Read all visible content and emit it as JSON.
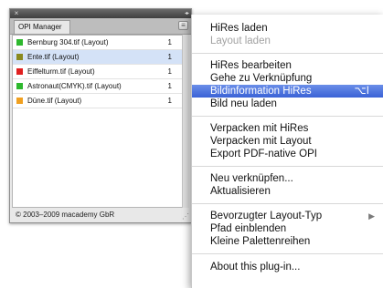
{
  "panel": {
    "tab_label": "OPI Manager",
    "footer": "© 2003–2009 macademy GbR",
    "rows": [
      {
        "name": "Bernburg 304.tif (Layout)",
        "count": "1",
        "color": "#2eb82e",
        "selected": false
      },
      {
        "name": "Ente.tif (Layout)",
        "count": "1",
        "color": "#8a8a20",
        "selected": true
      },
      {
        "name": "Eiffelturm.tif (Layout)",
        "count": "1",
        "color": "#e02020",
        "selected": false
      },
      {
        "name": "Astronaut(CMYK).tif (Layout)",
        "count": "1",
        "color": "#2eb82e",
        "selected": false
      },
      {
        "name": "Düne.tif (Layout)",
        "count": "1",
        "color": "#f0a020",
        "selected": false
      }
    ]
  },
  "menu": {
    "items": [
      {
        "label": "HiRes laden",
        "disabled": false
      },
      {
        "label": "Layout laden",
        "disabled": true
      },
      {
        "label": "HiRes bearbeiten",
        "disabled": false
      },
      {
        "label": "Gehe zu Verknüpfung",
        "disabled": false
      },
      {
        "label": "Bildinformation HiRes",
        "disabled": false,
        "highlighted": true,
        "shortcut": "⌥I"
      },
      {
        "label": "Bild neu laden",
        "disabled": false
      },
      {
        "label": "Verpacken mit HiRes",
        "disabled": false
      },
      {
        "label": "Verpacken mit Layout",
        "disabled": false
      },
      {
        "label": "Export PDF-native OPI",
        "disabled": false
      },
      {
        "label": "Neu verknüpfen...",
        "disabled": false
      },
      {
        "label": "Aktualisieren",
        "disabled": false
      },
      {
        "label": "Bevorzugter Layout-Typ",
        "disabled": false,
        "submenu": true
      },
      {
        "label": "Pfad einblenden",
        "disabled": false
      },
      {
        "label": "Kleine Palettenreihen",
        "disabled": false
      },
      {
        "label": "About this plug-in...",
        "disabled": false
      }
    ]
  },
  "icons": {
    "close": "close-icon",
    "collapse": "collapse-arrows-icon",
    "panel_menu": "panel-menu-icon",
    "submenu": "submenu-arrow-icon",
    "resize": "resize-grip-icon"
  }
}
